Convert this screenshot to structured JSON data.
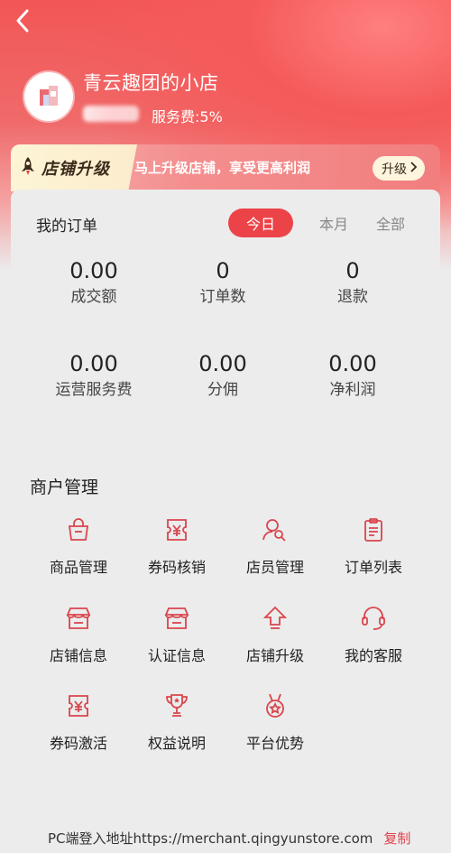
{
  "header": {
    "store_name": "青云趣团的小店",
    "service_fee": "服务费:5%"
  },
  "banner": {
    "title": "店铺升级",
    "text": "马上升级店铺，享受更高利润",
    "button_label": "升级"
  },
  "orders": {
    "title": "我的订单",
    "tabs": [
      {
        "label": "今日",
        "active": true
      },
      {
        "label": "本月",
        "active": false
      },
      {
        "label": "全部",
        "active": false
      }
    ],
    "stats": [
      {
        "value": "0.00",
        "label": "成交额"
      },
      {
        "value": "0",
        "label": "订单数"
      },
      {
        "value": "0",
        "label": "退款"
      },
      {
        "value": "0.00",
        "label": "运营服务费"
      },
      {
        "value": "0.00",
        "label": "分佣"
      },
      {
        "value": "0.00",
        "label": "净利润"
      }
    ]
  },
  "merchant": {
    "title": "商户管理",
    "items": [
      {
        "label": "商品管理",
        "icon": "shopping-bag-icon"
      },
      {
        "label": "券码核销",
        "icon": "coupon-verify-icon"
      },
      {
        "label": "店员管理",
        "icon": "staff-search-icon"
      },
      {
        "label": "订单列表",
        "icon": "clipboard-list-icon"
      },
      {
        "label": "店铺信息",
        "icon": "storefront-icon"
      },
      {
        "label": "认证信息",
        "icon": "storefront-verify-icon"
      },
      {
        "label": "店铺升级",
        "icon": "arrow-up-icon"
      },
      {
        "label": "我的客服",
        "icon": "headset-icon"
      },
      {
        "label": "券码激活",
        "icon": "coupon-activate-icon"
      },
      {
        "label": "权益说明",
        "icon": "trophy-icon"
      },
      {
        "label": "平台优势",
        "icon": "medal-icon"
      }
    ]
  },
  "footer": {
    "text": "PC端登入地址https://merchant.qingyunstore.com",
    "copy_label": "复制"
  },
  "colors": {
    "accent": "#ec4349",
    "icon": "#d9464c",
    "banner_gold": "#fdf5d6"
  }
}
